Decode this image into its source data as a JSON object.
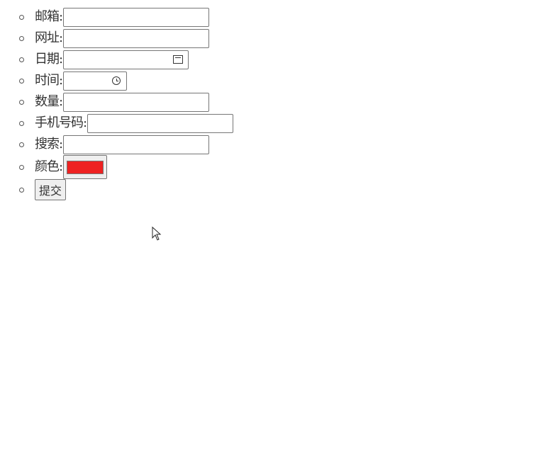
{
  "form": {
    "fields": [
      {
        "label": "邮箱:",
        "type": "email",
        "value": ""
      },
      {
        "label": "网址:",
        "type": "url",
        "value": ""
      },
      {
        "label": "日期:",
        "type": "date",
        "value": ""
      },
      {
        "label": "时间:",
        "type": "time",
        "value": ""
      },
      {
        "label": "数量:",
        "type": "number",
        "value": ""
      },
      {
        "label": "手机号码:",
        "type": "tel",
        "value": ""
      },
      {
        "label": "搜索:",
        "type": "search",
        "value": ""
      },
      {
        "label": "颜色:",
        "type": "color",
        "value": "#ee2222"
      }
    ],
    "submit_label": "提交"
  },
  "colors": {
    "swatch": "#ee2222"
  },
  "icons": {
    "date": "calendar-icon",
    "time": "clock-icon",
    "pointer": "mouse-cursor-icon"
  }
}
